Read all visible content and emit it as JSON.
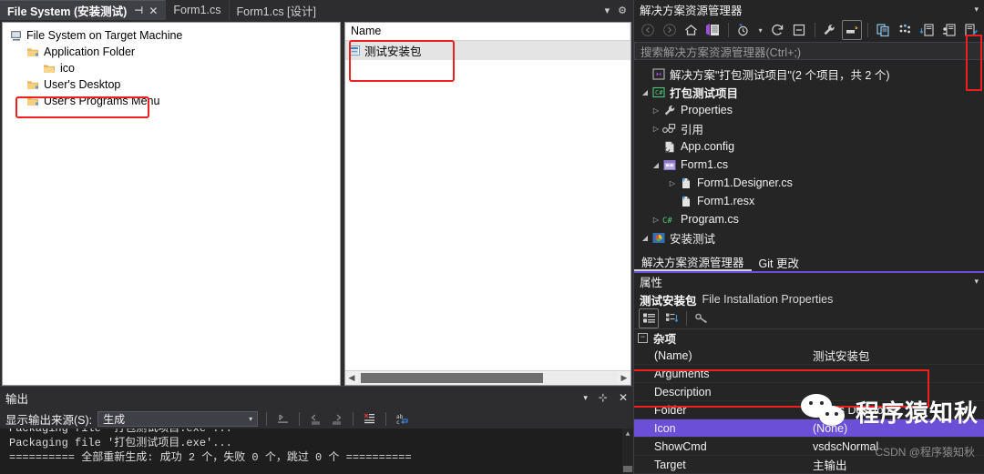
{
  "tabs": [
    {
      "label": "File System (安装测试)",
      "active": true,
      "pin": "⊣",
      "close": "✕"
    },
    {
      "label": "Form1.cs",
      "active": false
    },
    {
      "label": "Form1.cs [设计]",
      "active": false
    }
  ],
  "tabstrip_icons": {
    "overflow": "▾",
    "settings": "⚙"
  },
  "file_system_tree": {
    "nodes": [
      {
        "label": "File System on Target Machine",
        "indent": 0,
        "icon": "computer-icon"
      },
      {
        "label": "Application Folder",
        "indent": 1,
        "icon": "folder-icon"
      },
      {
        "label": "ico",
        "indent": 2,
        "icon": "folder-plain-icon"
      },
      {
        "label": "User's Desktop",
        "indent": 1,
        "icon": "folder-icon",
        "highlighted": true
      },
      {
        "label": "User's Programs Menu",
        "indent": 1,
        "icon": "folder-icon"
      }
    ]
  },
  "file_list": {
    "column_header": "Name",
    "rows": [
      {
        "name": "测试安装包",
        "icon": "installer-file-icon",
        "selected": true,
        "highlighted": true
      }
    ]
  },
  "output_window": {
    "title": "输出",
    "title_buttons": {
      "dropdown": "▾",
      "pin": "⊹",
      "close": "✕"
    },
    "source_label": "显示输出来源(S):",
    "source_value": "生成",
    "toolbar_icons": [
      "clear-all-icon",
      "navigate-previous-icon",
      "navigate-next-icon",
      "clear-output-icon",
      "word-wrap-icon"
    ],
    "lines": [
      "Packaging file '打包测试项目.exe'...",
      "Packaging file '打包测试项目.exe'...",
      "========== 全部重新生成: 成功 2 个，失败 0 个，跳过 0 个 =========="
    ]
  },
  "solution_explorer": {
    "title": "解决方案资源管理器",
    "chevron": "▾",
    "toolbar_icons": [
      "back-icon",
      "forward-icon",
      "home-icon",
      "solution-explorer-icon",
      "pending-changes-icon",
      "dropdown-icon",
      "refresh-icon",
      "collapse-all-icon",
      "properties-wrench-icon",
      "show-all-files-icon",
      "copy-icon",
      "preview-selected-icon",
      "new-folder-icon",
      "add-user-icon",
      "edit-icon"
    ],
    "search_placeholder": "搜索解决方案资源管理器(Ctrl+;)",
    "tree": [
      {
        "label": "解决方案\"打包测试项目\"(2 个项目，共 2 个)",
        "indent": 0,
        "icon": "solution-icon",
        "arrow": "",
        "bold": false
      },
      {
        "label": "打包测试项目",
        "indent": 0,
        "icon": "csharp-project-icon",
        "arrow": "◢",
        "bold": true
      },
      {
        "label": "Properties",
        "indent": 1,
        "icon": "wrench-icon",
        "arrow": "▷",
        "bold": false
      },
      {
        "label": "引用",
        "indent": 1,
        "icon": "references-icon",
        "arrow": "▷",
        "bold": false
      },
      {
        "label": "App.config",
        "indent": 1,
        "icon": "config-file-icon",
        "arrow": "",
        "bold": false
      },
      {
        "label": "Form1.cs",
        "indent": 1,
        "icon": "form-icon",
        "arrow": "◢",
        "bold": false
      },
      {
        "label": "Form1.Designer.cs",
        "indent": 2,
        "icon": "cs-file-icon",
        "arrow": "▷",
        "bold": false
      },
      {
        "label": "Form1.resx",
        "indent": 2,
        "icon": "cs-file-icon",
        "arrow": "",
        "bold": false
      },
      {
        "label": "Program.cs",
        "indent": 1,
        "icon": "csharp-file-icon",
        "arrow": "▷",
        "bold": false
      },
      {
        "label": "安装测试",
        "indent": 0,
        "icon": "setup-project-icon",
        "arrow": "◢",
        "bold": false
      }
    ],
    "tabs": [
      {
        "label": "解决方案资源管理器",
        "active": true
      },
      {
        "label": "Git 更改",
        "active": false
      }
    ]
  },
  "properties": {
    "title": "属性",
    "chevron": "▾",
    "object_name": "测试安装包",
    "object_type": "File Installation Properties",
    "toolbar_icons": [
      "categorized-icon",
      "alphabetical-icon",
      "property-pages-icon"
    ],
    "category": "杂项",
    "category_toggle": "−",
    "rows": [
      {
        "name": "(Name)",
        "value": "测试安装包",
        "selected": false
      },
      {
        "name": "Arguments",
        "value": "",
        "selected": false
      },
      {
        "name": "Description",
        "value": "",
        "selected": false
      },
      {
        "name": "Folder",
        "value": "User's Desktop",
        "selected": false,
        "highlighted": true
      },
      {
        "name": "Icon",
        "value": "(None)",
        "selected": true,
        "highlighted": true
      },
      {
        "name": "ShowCmd",
        "value": "vsdscNormal",
        "selected": false
      },
      {
        "name": "Target",
        "value": "主输出",
        "selected": false
      }
    ]
  },
  "watermark": {
    "text": "程序猿知秋",
    "credit": "CSDN @程序猿知秋"
  },
  "colors": {
    "accent_purple": "#6b4fd6",
    "highlight_red": "#f01f1f",
    "chrome_bg": "#2d2d30",
    "panel_bg": "#252526",
    "editor_bg": "#1e1e1e"
  }
}
